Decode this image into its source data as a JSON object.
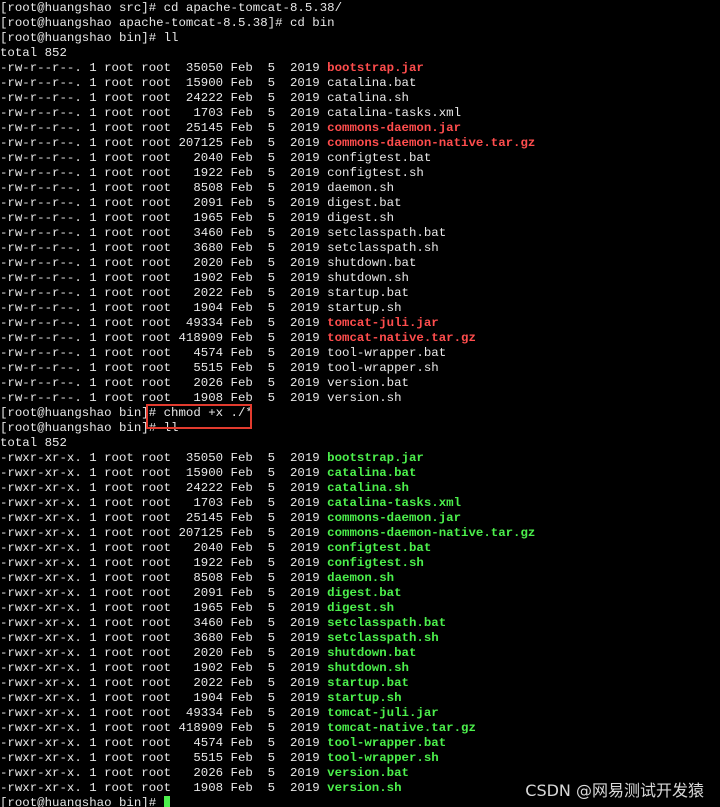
{
  "terminal": {
    "lines": [
      {
        "segments": [
          {
            "text": "[root@huangshao src]# cd apache-tomcat-8.5.38/",
            "color": "plain"
          }
        ]
      },
      {
        "segments": [
          {
            "text": "[root@huangshao apache-tomcat-8.5.38]# cd bin",
            "color": "plain"
          }
        ]
      },
      {
        "segments": [
          {
            "text": "[root@huangshao bin]# ll",
            "color": "plain"
          }
        ]
      },
      {
        "segments": [
          {
            "text": "total 852",
            "color": "plain"
          }
        ]
      },
      {
        "segments": [
          {
            "text": "-rw-r--r--. 1 root root  35050 Feb  5  2019 ",
            "color": "plain"
          },
          {
            "text": "bootstrap.jar",
            "color": "red"
          }
        ]
      },
      {
        "segments": [
          {
            "text": "-rw-r--r--. 1 root root  15900 Feb  5  2019 catalina.bat",
            "color": "plain"
          }
        ]
      },
      {
        "segments": [
          {
            "text": "-rw-r--r--. 1 root root  24222 Feb  5  2019 catalina.sh",
            "color": "plain"
          }
        ]
      },
      {
        "segments": [
          {
            "text": "-rw-r--r--. 1 root root   1703 Feb  5  2019 catalina-tasks.xml",
            "color": "plain"
          }
        ]
      },
      {
        "segments": [
          {
            "text": "-rw-r--r--. 1 root root  25145 Feb  5  2019 ",
            "color": "plain"
          },
          {
            "text": "commons-daemon.jar",
            "color": "red"
          }
        ]
      },
      {
        "segments": [
          {
            "text": "-rw-r--r--. 1 root root 207125 Feb  5  2019 ",
            "color": "plain"
          },
          {
            "text": "commons-daemon-native.tar.gz",
            "color": "red"
          }
        ]
      },
      {
        "segments": [
          {
            "text": "-rw-r--r--. 1 root root   2040 Feb  5  2019 configtest.bat",
            "color": "plain"
          }
        ]
      },
      {
        "segments": [
          {
            "text": "-rw-r--r--. 1 root root   1922 Feb  5  2019 configtest.sh",
            "color": "plain"
          }
        ]
      },
      {
        "segments": [
          {
            "text": "-rw-r--r--. 1 root root   8508 Feb  5  2019 daemon.sh",
            "color": "plain"
          }
        ]
      },
      {
        "segments": [
          {
            "text": "-rw-r--r--. 1 root root   2091 Feb  5  2019 digest.bat",
            "color": "plain"
          }
        ]
      },
      {
        "segments": [
          {
            "text": "-rw-r--r--. 1 root root   1965 Feb  5  2019 digest.sh",
            "color": "plain"
          }
        ]
      },
      {
        "segments": [
          {
            "text": "-rw-r--r--. 1 root root   3460 Feb  5  2019 setclasspath.bat",
            "color": "plain"
          }
        ]
      },
      {
        "segments": [
          {
            "text": "-rw-r--r--. 1 root root   3680 Feb  5  2019 setclasspath.sh",
            "color": "plain"
          }
        ]
      },
      {
        "segments": [
          {
            "text": "-rw-r--r--. 1 root root   2020 Feb  5  2019 shutdown.bat",
            "color": "plain"
          }
        ]
      },
      {
        "segments": [
          {
            "text": "-rw-r--r--. 1 root root   1902 Feb  5  2019 shutdown.sh",
            "color": "plain"
          }
        ]
      },
      {
        "segments": [
          {
            "text": "-rw-r--r--. 1 root root   2022 Feb  5  2019 startup.bat",
            "color": "plain"
          }
        ]
      },
      {
        "segments": [
          {
            "text": "-rw-r--r--. 1 root root   1904 Feb  5  2019 startup.sh",
            "color": "plain"
          }
        ]
      },
      {
        "segments": [
          {
            "text": "-rw-r--r--. 1 root root  49334 Feb  5  2019 ",
            "color": "plain"
          },
          {
            "text": "tomcat-juli.jar",
            "color": "red"
          }
        ]
      },
      {
        "segments": [
          {
            "text": "-rw-r--r--. 1 root root 418909 Feb  5  2019 ",
            "color": "plain"
          },
          {
            "text": "tomcat-native.tar.gz",
            "color": "red"
          }
        ]
      },
      {
        "segments": [
          {
            "text": "-rw-r--r--. 1 root root   4574 Feb  5  2019 tool-wrapper.bat",
            "color": "plain"
          }
        ]
      },
      {
        "segments": [
          {
            "text": "-rw-r--r--. 1 root root   5515 Feb  5  2019 tool-wrapper.sh",
            "color": "plain"
          }
        ]
      },
      {
        "segments": [
          {
            "text": "-rw-r--r--. 1 root root   2026 Feb  5  2019 version.bat",
            "color": "plain"
          }
        ]
      },
      {
        "segments": [
          {
            "text": "-rw-r--r--. 1 root root   1908 Feb  5  2019 version.sh",
            "color": "plain"
          }
        ]
      },
      {
        "segments": [
          {
            "text": "[root@huangshao bin]# chmod +x ./*",
            "color": "plain"
          }
        ]
      },
      {
        "segments": [
          {
            "text": "[root@huangshao bin]# ll",
            "color": "plain"
          }
        ]
      },
      {
        "segments": [
          {
            "text": "total 852",
            "color": "plain"
          }
        ]
      },
      {
        "segments": [
          {
            "text": "-rwxr-xr-x. 1 root root  35050 Feb  5  2019 ",
            "color": "plain"
          },
          {
            "text": "bootstrap.jar",
            "color": "green"
          }
        ]
      },
      {
        "segments": [
          {
            "text": "-rwxr-xr-x. 1 root root  15900 Feb  5  2019 ",
            "color": "plain"
          },
          {
            "text": "catalina.bat",
            "color": "green"
          }
        ]
      },
      {
        "segments": [
          {
            "text": "-rwxr-xr-x. 1 root root  24222 Feb  5  2019 ",
            "color": "plain"
          },
          {
            "text": "catalina.sh",
            "color": "green"
          }
        ]
      },
      {
        "segments": [
          {
            "text": "-rwxr-xr-x. 1 root root   1703 Feb  5  2019 ",
            "color": "plain"
          },
          {
            "text": "catalina-tasks.xml",
            "color": "green"
          }
        ]
      },
      {
        "segments": [
          {
            "text": "-rwxr-xr-x. 1 root root  25145 Feb  5  2019 ",
            "color": "plain"
          },
          {
            "text": "commons-daemon.jar",
            "color": "green"
          }
        ]
      },
      {
        "segments": [
          {
            "text": "-rwxr-xr-x. 1 root root 207125 Feb  5  2019 ",
            "color": "plain"
          },
          {
            "text": "commons-daemon-native.tar.gz",
            "color": "green"
          }
        ]
      },
      {
        "segments": [
          {
            "text": "-rwxr-xr-x. 1 root root   2040 Feb  5  2019 ",
            "color": "plain"
          },
          {
            "text": "configtest.bat",
            "color": "green"
          }
        ]
      },
      {
        "segments": [
          {
            "text": "-rwxr-xr-x. 1 root root   1922 Feb  5  2019 ",
            "color": "plain"
          },
          {
            "text": "configtest.sh",
            "color": "green"
          }
        ]
      },
      {
        "segments": [
          {
            "text": "-rwxr-xr-x. 1 root root   8508 Feb  5  2019 ",
            "color": "plain"
          },
          {
            "text": "daemon.sh",
            "color": "green"
          }
        ]
      },
      {
        "segments": [
          {
            "text": "-rwxr-xr-x. 1 root root   2091 Feb  5  2019 ",
            "color": "plain"
          },
          {
            "text": "digest.bat",
            "color": "green"
          }
        ]
      },
      {
        "segments": [
          {
            "text": "-rwxr-xr-x. 1 root root   1965 Feb  5  2019 ",
            "color": "plain"
          },
          {
            "text": "digest.sh",
            "color": "green"
          }
        ]
      },
      {
        "segments": [
          {
            "text": "-rwxr-xr-x. 1 root root   3460 Feb  5  2019 ",
            "color": "plain"
          },
          {
            "text": "setclasspath.bat",
            "color": "green"
          }
        ]
      },
      {
        "segments": [
          {
            "text": "-rwxr-xr-x. 1 root root   3680 Feb  5  2019 ",
            "color": "plain"
          },
          {
            "text": "setclasspath.sh",
            "color": "green"
          }
        ]
      },
      {
        "segments": [
          {
            "text": "-rwxr-xr-x. 1 root root   2020 Feb  5  2019 ",
            "color": "plain"
          },
          {
            "text": "shutdown.bat",
            "color": "green"
          }
        ]
      },
      {
        "segments": [
          {
            "text": "-rwxr-xr-x. 1 root root   1902 Feb  5  2019 ",
            "color": "plain"
          },
          {
            "text": "shutdown.sh",
            "color": "green"
          }
        ]
      },
      {
        "segments": [
          {
            "text": "-rwxr-xr-x. 1 root root   2022 Feb  5  2019 ",
            "color": "plain"
          },
          {
            "text": "startup.bat",
            "color": "green"
          }
        ]
      },
      {
        "segments": [
          {
            "text": "-rwxr-xr-x. 1 root root   1904 Feb  5  2019 ",
            "color": "plain"
          },
          {
            "text": "startup.sh",
            "color": "green"
          }
        ]
      },
      {
        "segments": [
          {
            "text": "-rwxr-xr-x. 1 root root  49334 Feb  5  2019 ",
            "color": "plain"
          },
          {
            "text": "tomcat-juli.jar",
            "color": "green"
          }
        ]
      },
      {
        "segments": [
          {
            "text": "-rwxr-xr-x. 1 root root 418909 Feb  5  2019 ",
            "color": "plain"
          },
          {
            "text": "tomcat-native.tar.gz",
            "color": "green"
          }
        ]
      },
      {
        "segments": [
          {
            "text": "-rwxr-xr-x. 1 root root   4574 Feb  5  2019 ",
            "color": "plain"
          },
          {
            "text": "tool-wrapper.bat",
            "color": "green"
          }
        ]
      },
      {
        "segments": [
          {
            "text": "-rwxr-xr-x. 1 root root   5515 Feb  5  2019 ",
            "color": "plain"
          },
          {
            "text": "tool-wrapper.sh",
            "color": "green"
          }
        ]
      },
      {
        "segments": [
          {
            "text": "-rwxr-xr-x. 1 root root   2026 Feb  5  2019 ",
            "color": "plain"
          },
          {
            "text": "version.bat",
            "color": "green"
          }
        ]
      },
      {
        "segments": [
          {
            "text": "-rwxr-xr-x. 1 root root   1908 Feb  5  2019 ",
            "color": "plain"
          },
          {
            "text": "version.sh",
            "color": "green"
          }
        ]
      },
      {
        "segments": [
          {
            "text": "[root@huangshao bin]# ",
            "color": "plain"
          }
        ],
        "cursor": true
      }
    ],
    "colors": {
      "background": "#000000",
      "text": "#e8e8e8",
      "archive_red": "#ff4d4d",
      "executable_green": "#4cf04c",
      "highlight_box": "#e23b2e"
    }
  },
  "watermark": {
    "text": "CSDN @网易测试开发猿"
  }
}
